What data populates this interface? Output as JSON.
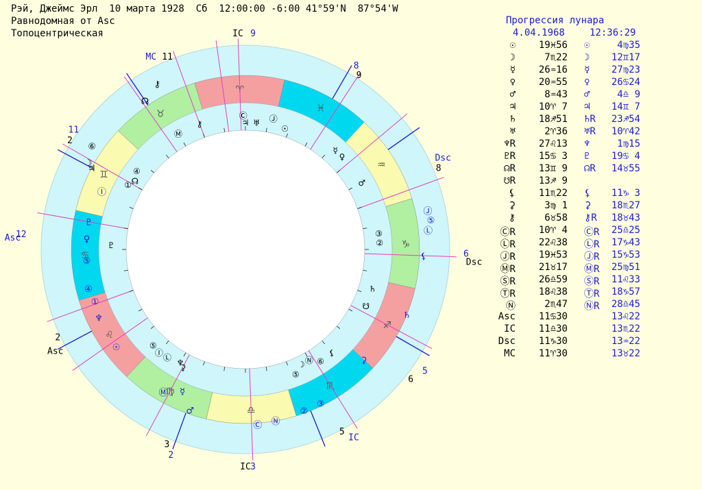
{
  "header": {
    "line1": "Рэй, Джеймс Эрл  10 марта 1928  Сб  12:00:00 -6:00 41°59'N  87°54'W",
    "line2": "Равнодомная от Asc",
    "line3": "Топоцентрическая"
  },
  "table": {
    "title": "Прогрессия лунара",
    "date": "4.04.1968",
    "time": "12:36:29",
    "rows": [
      {
        "sym": "☉",
        "natal": "19♓56",
        "psym": "☉",
        "prog": "4♍35"
      },
      {
        "sym": "☽",
        "natal": "7♏22",
        "psym": "☽",
        "prog": "12♊17"
      },
      {
        "sym": "☿",
        "natal": "26♒16",
        "psym": "☿",
        "prog": "27♍23"
      },
      {
        "sym": "♀",
        "natal": "20♒55",
        "psym": "♀",
        "prog": "26♋24"
      },
      {
        "sym": "♂",
        "natal": "8♒43",
        "psym": "♂",
        "prog": "4♎ 9"
      },
      {
        "sym": "♃",
        "natal": "10♈ 7",
        "psym": "♃",
        "prog": "14♊ 7"
      },
      {
        "sym": "♄",
        "natal": "18♐51",
        "psym": "♄R",
        "prog": "23♐54"
      },
      {
        "sym": "♅",
        "natal": "2♈36",
        "psym": "♅R",
        "prog": "10♈42"
      },
      {
        "sym": "♆R",
        "natal": "27♌13",
        "psym": "♆",
        "prog": "1♍15"
      },
      {
        "sym": "♇R",
        "natal": "15♋ 3",
        "psym": "♇",
        "prog": "19♋ 4"
      },
      {
        "sym": "☊R",
        "natal": "13♊ 9",
        "psym": "☊R",
        "prog": "14♉55"
      },
      {
        "sym": "☋R",
        "natal": "13♐ 9",
        "psym": "",
        "prog": ""
      },
      {
        "sym": "⚸",
        "natal": "11♏22",
        "psym": "⚸",
        "prog": "11♑ 3"
      },
      {
        "sym": "⚳",
        "natal": "3♍ 1",
        "psym": "⚳",
        "prog": "18♏27"
      },
      {
        "sym": "⚷",
        "natal": "6♉58",
        "psym": "⚷R",
        "prog": "18♉43"
      },
      {
        "sym": "ⒸR",
        "natal": "10♈ 4",
        "psym": "ⒸR",
        "prog": "25♎25"
      },
      {
        "sym": "ⓁR",
        "natal": "22♌38",
        "psym": "ⓁR",
        "prog": "17♑43"
      },
      {
        "sym": "ⒿR",
        "natal": "19♓53",
        "psym": "ⒿR",
        "prog": "15♑53"
      },
      {
        "sym": "ⓂR",
        "natal": "21♉17",
        "psym": "ⓂR",
        "prog": "25♍51"
      },
      {
        "sym": "ⓈR",
        "natal": "26♎59",
        "psym": "ⓈR",
        "prog": "11♌33"
      },
      {
        "sym": "ⓉR",
        "natal": "18♌38",
        "psym": "ⓉR",
        "prog": "18♑57"
      },
      {
        "sym": "Ⓝ",
        "natal": "2♏47",
        "psym": "ⓃR",
        "prog": "28♎45"
      },
      {
        "sym": "Asc",
        "natal": "11♋30",
        "psym": "",
        "prog": "13♌22"
      },
      {
        "sym": "IC",
        "natal": "11♎30",
        "psym": "",
        "prog": "13♏22"
      },
      {
        "sym": "Dsc",
        "natal": "11♑30",
        "psym": "",
        "prog": "13♒22"
      },
      {
        "sym": "MC",
        "natal": "11♈30",
        "psym": "",
        "prog": "13♉22"
      }
    ]
  },
  "wheel": {
    "signs": [
      {
        "glyph": "♈",
        "color": "#f4a0a0"
      },
      {
        "glyph": "♓",
        "color": "#00d8f0"
      },
      {
        "glyph": "♒",
        "color": "#fafab0"
      },
      {
        "glyph": "♑",
        "color": "#b0f0a0"
      },
      {
        "glyph": "♐",
        "color": "#f4a0a0"
      },
      {
        "glyph": "♏",
        "color": "#00d8f0"
      },
      {
        "glyph": "♎",
        "color": "#fafab0"
      },
      {
        "glyph": "♍",
        "color": "#b0f0a0"
      },
      {
        "glyph": "♌",
        "color": "#f4a0a0"
      },
      {
        "glyph": "♋",
        "color": "#00d8f0"
      },
      {
        "glyph": "♊",
        "color": "#fafab0"
      },
      {
        "glyph": "♉",
        "color": "#b0f0a0"
      }
    ],
    "outer_labels": [
      {
        "text": "IC",
        "color": "#000000"
      },
      {
        "text": "9",
        "color": "#1a1ad0"
      },
      {
        "text": "MC",
        "color": "#1a1ad0"
      },
      {
        "text": "11",
        "color": "#000000"
      },
      {
        "text": "11",
        "color": "#1a1ad0"
      },
      {
        "text": "2",
        "color": "#000000"
      },
      {
        "text": "Asc",
        "color": "#000000"
      },
      {
        "text": "12",
        "color": "#1a1ad0"
      },
      {
        "text": "Asc",
        "color": "#1a1ad0"
      },
      {
        "text": "2",
        "color": "#000000"
      },
      {
        "text": "3",
        "color": "#000000"
      },
      {
        "text": "2",
        "color": "#1a1ad0"
      },
      {
        "text": "IC",
        "color": "#000000"
      },
      {
        "text": "3",
        "color": "#1a1ad0"
      },
      {
        "text": "5",
        "color": "#000000"
      },
      {
        "text": "IC",
        "color": "#1a1ad0"
      },
      {
        "text": "6",
        "color": "#000000"
      },
      {
        "text": "5",
        "color": "#1a1ad0"
      },
      {
        "text": "6",
        "color": "#1a1ad0"
      },
      {
        "text": "Dsc",
        "color": "#000000"
      },
      {
        "text": "Dsc",
        "color": "#1a1ad0"
      },
      {
        "text": "8",
        "color": "#000000"
      },
      {
        "text": "8",
        "color": "#1a1ad0"
      },
      {
        "text": "9",
        "color": "#000000"
      }
    ],
    "prog_glyphs": [
      {
        "g": "⚷",
        "c": "#000000"
      },
      {
        "g": "☊",
        "c": "#000000"
      },
      {
        "g": "⑥",
        "c": "#000000"
      },
      {
        "g": "☽",
        "c": "#000000"
      },
      {
        "g": "♃",
        "c": "#000000"
      },
      {
        "g": "Ⓘ",
        "c": "#1a1ad0"
      },
      {
        "g": "♇",
        "c": "#1a1ad0"
      },
      {
        "g": "♀",
        "c": "#1a1ad0"
      },
      {
        "g": "⑤",
        "c": "#1a1ad0"
      },
      {
        "g": "④",
        "c": "#1a1ad0"
      },
      {
        "g": "①",
        "c": "#1a1ad0"
      },
      {
        "g": "♆",
        "c": "#1a1ad0"
      },
      {
        "g": "☉",
        "c": "#1a1ad0"
      },
      {
        "g": "Ⓜ",
        "c": "#1a1ad0"
      },
      {
        "g": "☿",
        "c": "#1a1ad0"
      },
      {
        "g": "♂",
        "c": "#1a1ad0"
      },
      {
        "g": "Ⓒ",
        "c": "#1a1ad0"
      },
      {
        "g": "Ⓝ",
        "c": "#1a1ad0"
      },
      {
        "g": "②",
        "c": "#1a1ad0"
      },
      {
        "g": "③",
        "c": "#1a1ad0"
      },
      {
        "g": "⚳",
        "c": "#1a1ad0"
      },
      {
        "g": "♄",
        "c": "#1a1ad0"
      },
      {
        "g": "⚸",
        "c": "#1a1ad0"
      },
      {
        "g": "Ⓛ",
        "c": "#1a1ad0"
      },
      {
        "g": "⑤",
        "c": "#1a1ad0"
      },
      {
        "g": "Ⓙ",
        "c": "#1a1ad0"
      },
      {
        "g": "♅",
        "c": "#1a1ad0"
      }
    ],
    "natal_glyphs": [
      {
        "g": "Ⓒ",
        "c": "#000000"
      },
      {
        "g": "♃",
        "c": "#000000"
      },
      {
        "g": "♅",
        "c": "#000000"
      },
      {
        "g": "Ⓙ",
        "c": "#000000"
      },
      {
        "g": "☉",
        "c": "#000000"
      },
      {
        "g": "☿",
        "c": "#000000"
      },
      {
        "g": "♀",
        "c": "#000000"
      },
      {
        "g": "♂",
        "c": "#000000"
      },
      {
        "g": "③",
        "c": "#000000"
      },
      {
        "g": "②",
        "c": "#000000"
      },
      {
        "g": "♄",
        "c": "#000000"
      },
      {
        "g": "☋",
        "c": "#000000"
      },
      {
        "g": "⚸",
        "c": "#000000"
      },
      {
        "g": "⑥",
        "c": "#000000"
      },
      {
        "g": "Ⓝ",
        "c": "#000000"
      },
      {
        "g": "⑤",
        "c": "#000000"
      },
      {
        "g": "☽",
        "c": "#000000"
      },
      {
        "g": "⚳",
        "c": "#000000"
      },
      {
        "g": "♆",
        "c": "#000000"
      },
      {
        "g": "Ⓛ",
        "c": "#000000"
      },
      {
        "g": "Ⓘ",
        "c": "#000000"
      },
      {
        "g": "⑤",
        "c": "#000000"
      },
      {
        "g": "♇",
        "c": "#000000"
      },
      {
        "g": "①",
        "c": "#000000"
      },
      {
        "g": "☊",
        "c": "#000000"
      },
      {
        "g": "④",
        "c": "#000000"
      },
      {
        "g": "Ⓜ",
        "c": "#000000"
      },
      {
        "g": "⚷",
        "c": "#000000"
      }
    ]
  }
}
